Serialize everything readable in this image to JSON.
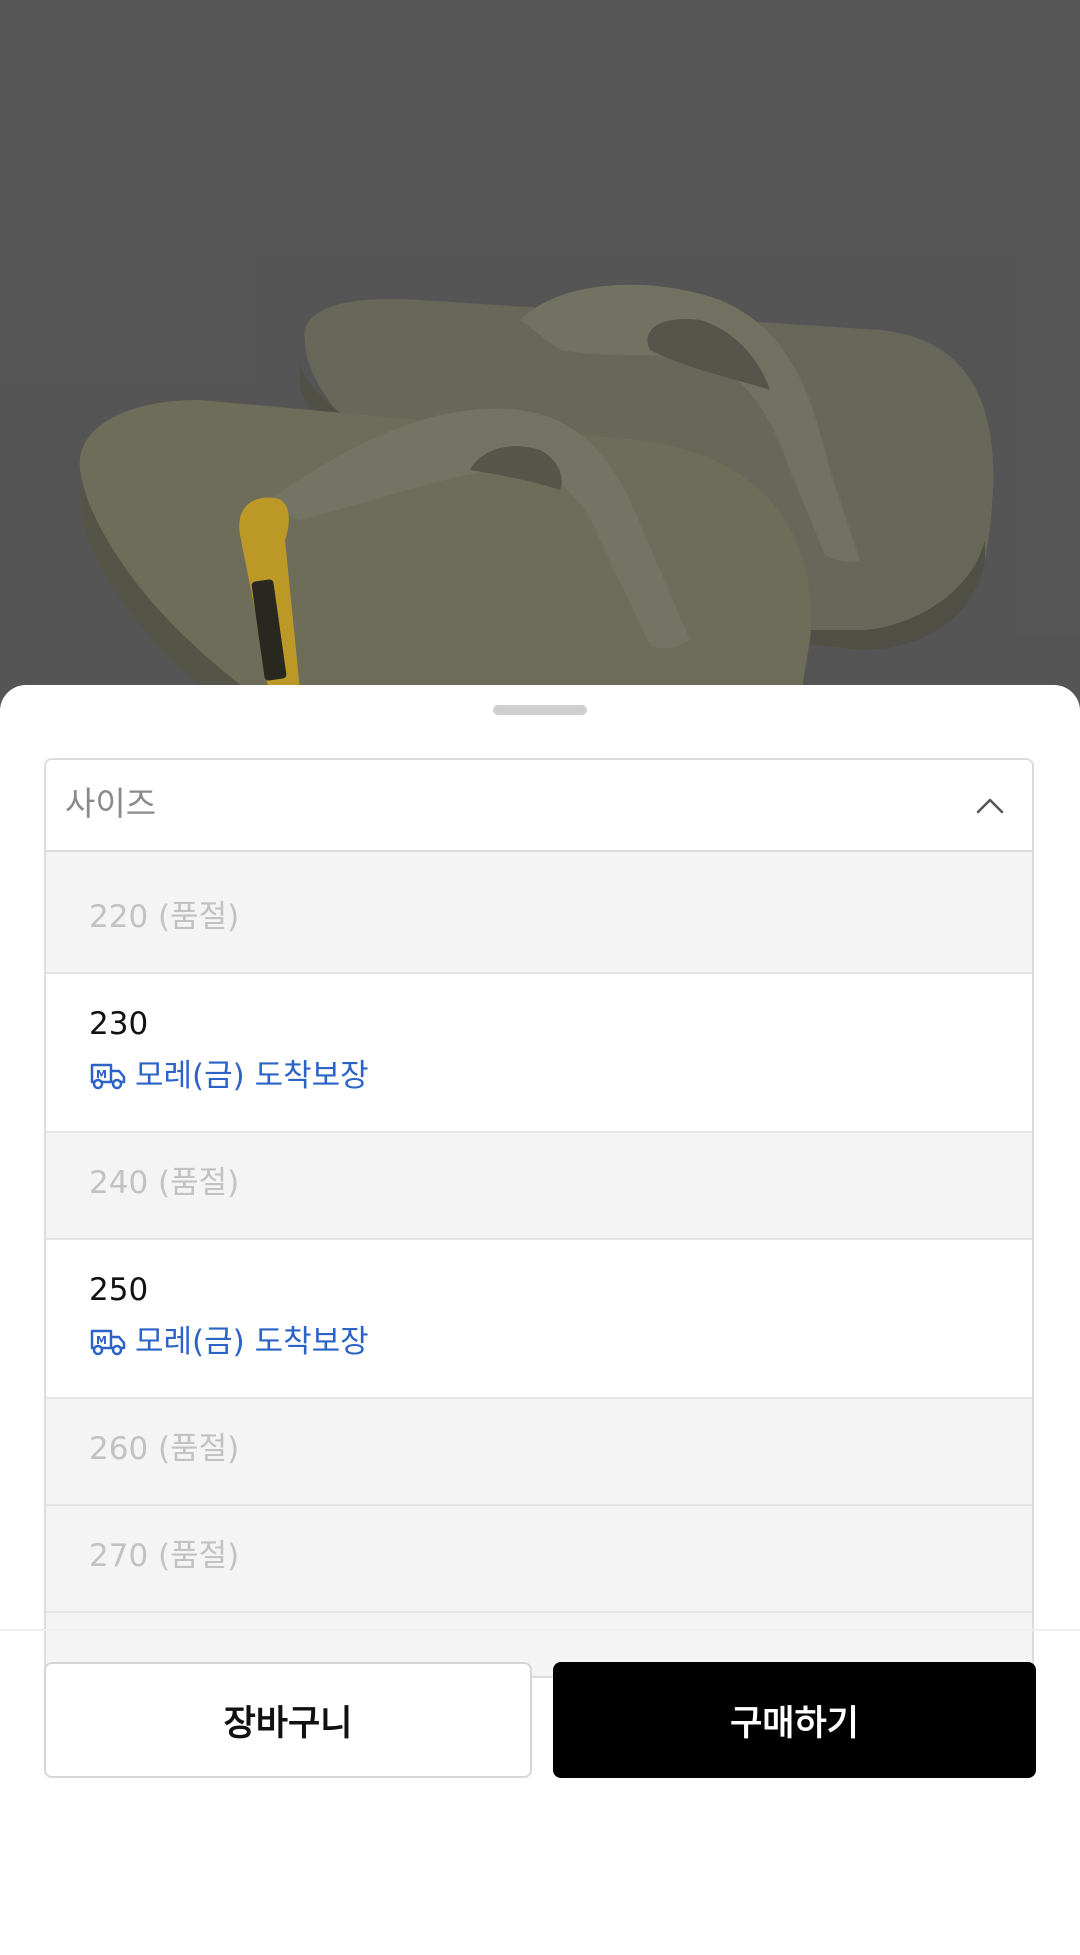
{
  "select": {
    "label": "사이즈",
    "options": [
      {
        "text": "220 (품절)",
        "available": false
      },
      {
        "text": "230",
        "available": true,
        "delivery": "모레(금) 도착보장"
      },
      {
        "text": "240 (품절)",
        "available": false
      },
      {
        "text": "250",
        "available": true,
        "delivery": "모레(금) 도착보장"
      },
      {
        "text": "260 (품절)",
        "available": false
      },
      {
        "text": "270 (품절)",
        "available": false
      }
    ]
  },
  "buttons": {
    "cart": "장바구니",
    "buy": "구매하기"
  },
  "colors": {
    "delivery_accent": "#2b63c6",
    "buy_button": "#000000",
    "soldout_text": "#c2c2c2"
  },
  "icons": {
    "dropdown": "chevron-up-icon",
    "delivery": "truck-icon"
  }
}
